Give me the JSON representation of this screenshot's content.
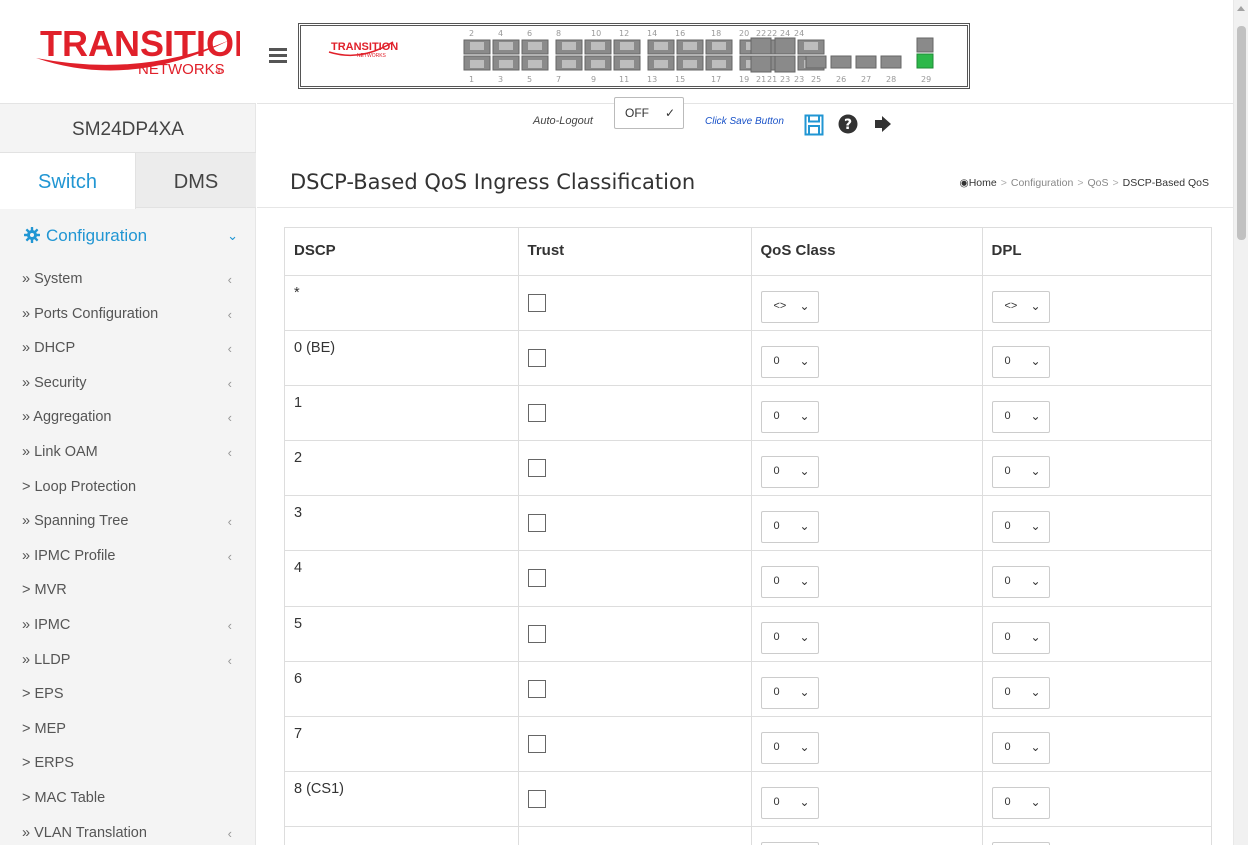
{
  "brand": {
    "logo_word": "TRANSITION",
    "logo_sub": "NETWORKS",
    "device_name": "SM24DP4XA"
  },
  "sidebar": {
    "tabs": [
      {
        "label": "Switch",
        "active": true
      },
      {
        "label": "DMS",
        "active": false
      }
    ],
    "section": {
      "label": "Configuration",
      "icon": "gear-icon",
      "expanded": true
    },
    "items": [
      {
        "label": "» System",
        "submenu": true
      },
      {
        "label": "» Ports Configuration",
        "submenu": true
      },
      {
        "label": "» DHCP",
        "submenu": true
      },
      {
        "label": "» Security",
        "submenu": true
      },
      {
        "label": "» Aggregation",
        "submenu": true
      },
      {
        "label": "» Link OAM",
        "submenu": true
      },
      {
        "label": "> Loop Protection",
        "submenu": false
      },
      {
        "label": "» Spanning Tree",
        "submenu": true
      },
      {
        "label": "» IPMC Profile",
        "submenu": true
      },
      {
        "label": "> MVR",
        "submenu": false
      },
      {
        "label": "» IPMC",
        "submenu": true
      },
      {
        "label": "» LLDP",
        "submenu": true
      },
      {
        "label": "> EPS",
        "submenu": false
      },
      {
        "label": "> MEP",
        "submenu": false
      },
      {
        "label": "> ERPS",
        "submenu": false
      },
      {
        "label": "> MAC Table",
        "submenu": false
      },
      {
        "label": "» VLAN Translation",
        "submenu": true
      }
    ]
  },
  "topbar": {
    "faceplate": {
      "top_port_labels": [
        "2",
        "4",
        "6",
        "8",
        "10",
        "12",
        "14",
        "16",
        "18",
        "20",
        "22",
        "24",
        "22",
        "24"
      ],
      "bottom_port_labels": [
        "1",
        "3",
        "5",
        "7",
        "9",
        "11",
        "13",
        "15",
        "17",
        "19",
        "21",
        "23",
        "21",
        "23",
        "25",
        "26",
        "27",
        "28",
        "29"
      ]
    },
    "auto_logout_label": "Auto-Logout",
    "auto_logout_value": "OFF",
    "save_hint": "Click Save Button",
    "icons": [
      "save-icon",
      "help-icon",
      "logout-icon"
    ]
  },
  "page": {
    "title": "DSCP-Based QoS Ingress Classification",
    "breadcrumb": [
      "Home",
      "Configuration",
      "QoS",
      "DSCP-Based QoS"
    ]
  },
  "table": {
    "headers": [
      "DSCP",
      "Trust",
      "QoS Class",
      "DPL"
    ],
    "rows": [
      {
        "dscp": "*",
        "trust": false,
        "qos_class": "<>",
        "dpl": "<>"
      },
      {
        "dscp": "0 (BE)",
        "trust": false,
        "qos_class": "0",
        "dpl": "0"
      },
      {
        "dscp": "1",
        "trust": false,
        "qos_class": "0",
        "dpl": "0"
      },
      {
        "dscp": "2",
        "trust": false,
        "qos_class": "0",
        "dpl": "0"
      },
      {
        "dscp": "3",
        "trust": false,
        "qos_class": "0",
        "dpl": "0"
      },
      {
        "dscp": "4",
        "trust": false,
        "qos_class": "0",
        "dpl": "0"
      },
      {
        "dscp": "5",
        "trust": false,
        "qos_class": "0",
        "dpl": "0"
      },
      {
        "dscp": "6",
        "trust": false,
        "qos_class": "0",
        "dpl": "0"
      },
      {
        "dscp": "7",
        "trust": false,
        "qos_class": "0",
        "dpl": "0"
      },
      {
        "dscp": "8 (CS1)",
        "trust": false,
        "qos_class": "0",
        "dpl": "0"
      },
      {
        "dscp": "",
        "trust": false,
        "qos_class": "",
        "dpl": ""
      }
    ]
  },
  "colors": {
    "accent": "#2196d3",
    "logo_red": "#e0202a",
    "link_blue": "#1a53c8",
    "port_green": "#2db84a"
  }
}
